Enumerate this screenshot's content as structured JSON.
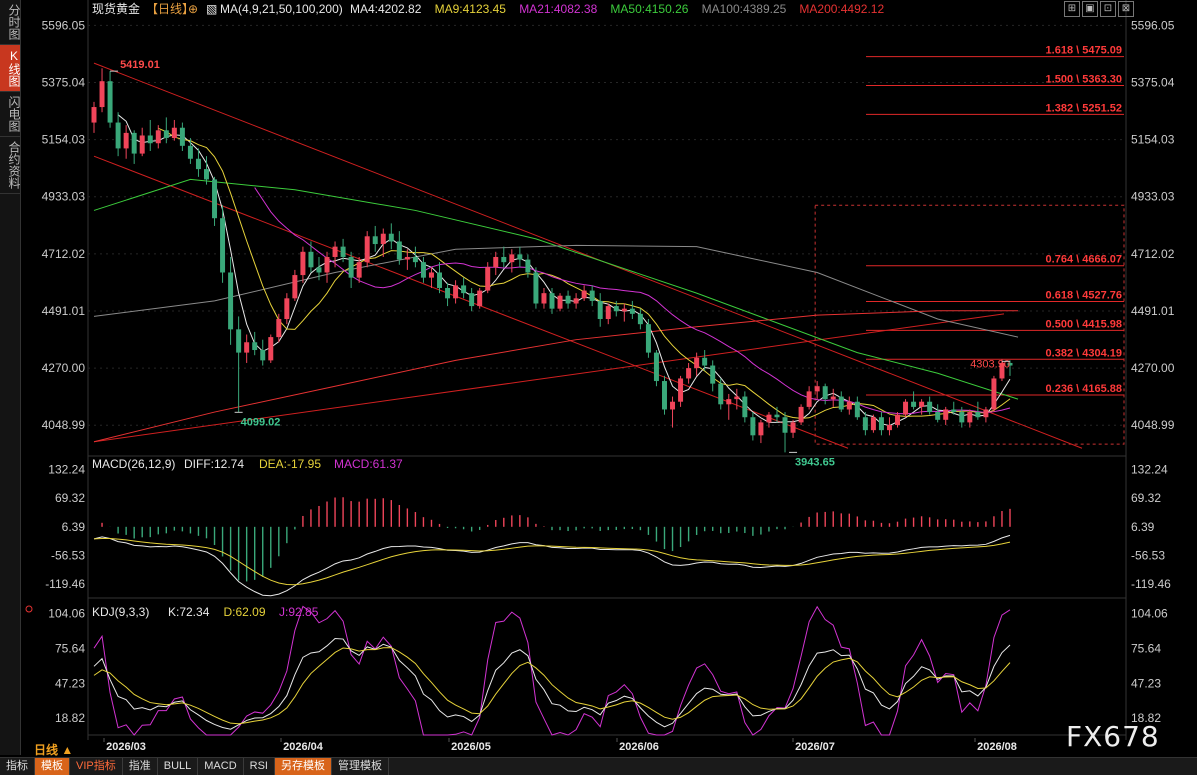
{
  "sidebar": {
    "tabs": [
      {
        "label": "分时图",
        "active": false
      },
      {
        "label": "K线图",
        "active": true
      },
      {
        "label": "闪电图",
        "active": false
      },
      {
        "label": "合约资料",
        "active": false
      }
    ]
  },
  "header": {
    "instrument": "现货黄金",
    "period_tag": "【日线】",
    "ma_title": "MA(4,9,21,50,100,200)",
    "ma_values": [
      {
        "label": "MA4:4202.82",
        "color": "#e8e8e8"
      },
      {
        "label": "MA9:4123.45",
        "color": "#e6d23a"
      },
      {
        "label": "MA21:4082.38",
        "color": "#d233d2"
      },
      {
        "label": "MA50:4150.26",
        "color": "#3ccc3c"
      },
      {
        "label": "MA100:4389.25",
        "color": "#8a8a8a"
      },
      {
        "label": "MA200:4492.12",
        "color": "#e63232"
      }
    ]
  },
  "toolbar": {
    "icons": [
      "expand-icon",
      "layout-icon",
      "window-icon",
      "close-icon"
    ],
    "glyphs": [
      "⊞",
      "▣",
      "⊡",
      "⊠"
    ]
  },
  "chart_data": [
    {
      "type": "candlestick",
      "title": "现货黄金 【日线】",
      "ylim": [
        3930,
        5640
      ],
      "y_ticks": [
        "5596.05",
        "5375.04",
        "5154.03",
        "4933.03",
        "4712.02",
        "4491.01",
        "4270.00",
        "4048.99"
      ],
      "x_ticks": [
        "2026/03",
        "2026/04",
        "2026/05",
        "2026/06",
        "2026/07",
        "2026/08"
      ],
      "candles": [
        [
          5220,
          5300,
          5180,
          5280
        ],
        [
          5280,
          5430,
          5260,
          5380
        ],
        [
          5380,
          5419,
          5200,
          5220
        ],
        [
          5220,
          5260,
          5090,
          5120
        ],
        [
          5120,
          5210,
          5080,
          5180
        ],
        [
          5180,
          5190,
          5060,
          5100
        ],
        [
          5100,
          5200,
          5090,
          5170
        ],
        [
          5170,
          5230,
          5110,
          5140
        ],
        [
          5140,
          5210,
          5120,
          5190
        ],
        [
          5190,
          5240,
          5140,
          5160
        ],
        [
          5160,
          5230,
          5150,
          5200
        ],
        [
          5200,
          5220,
          5110,
          5130
        ],
        [
          5130,
          5160,
          5060,
          5080
        ],
        [
          5080,
          5120,
          5010,
          5040
        ],
        [
          5040,
          5090,
          4980,
          5000
        ],
        [
          5000,
          5010,
          4820,
          4850
        ],
        [
          4850,
          4900,
          4600,
          4640
        ],
        [
          4640,
          4700,
          4360,
          4420
        ],
        [
          4420,
          4470,
          4099,
          4330
        ],
        [
          4330,
          4400,
          4290,
          4370
        ],
        [
          4370,
          4410,
          4320,
          4340
        ],
        [
          4340,
          4380,
          4280,
          4300
        ],
        [
          4300,
          4400,
          4290,
          4390
        ],
        [
          4390,
          4480,
          4370,
          4460
        ],
        [
          4460,
          4560,
          4440,
          4540
        ],
        [
          4540,
          4650,
          4530,
          4630
        ],
        [
          4630,
          4740,
          4600,
          4720
        ],
        [
          4720,
          4760,
          4640,
          4660
        ],
        [
          4660,
          4700,
          4610,
          4640
        ],
        [
          4640,
          4720,
          4600,
          4700
        ],
        [
          4700,
          4760,
          4660,
          4740
        ],
        [
          4740,
          4770,
          4680,
          4700
        ],
        [
          4700,
          4720,
          4580,
          4620
        ],
        [
          4620,
          4700,
          4600,
          4680
        ],
        [
          4680,
          4800,
          4660,
          4780
        ],
        [
          4780,
          4820,
          4720,
          4750
        ],
        [
          4750,
          4810,
          4700,
          4790
        ],
        [
          4790,
          4830,
          4730,
          4760
        ],
        [
          4760,
          4800,
          4670,
          4690
        ],
        [
          4690,
          4730,
          4650,
          4700
        ],
        [
          4700,
          4740,
          4660,
          4680
        ],
        [
          4680,
          4700,
          4600,
          4620
        ],
        [
          4620,
          4660,
          4580,
          4640
        ],
        [
          4640,
          4680,
          4560,
          4580
        ],
        [
          4580,
          4600,
          4510,
          4540
        ],
        [
          4540,
          4610,
          4520,
          4590
        ],
        [
          4590,
          4620,
          4540,
          4560
        ],
        [
          4560,
          4580,
          4490,
          4510
        ],
        [
          4510,
          4580,
          4500,
          4570
        ],
        [
          4570,
          4680,
          4560,
          4660
        ],
        [
          4660,
          4720,
          4630,
          4700
        ],
        [
          4700,
          4740,
          4660,
          4680
        ],
        [
          4680,
          4730,
          4640,
          4710
        ],
        [
          4710,
          4740,
          4660,
          4690
        ],
        [
          4690,
          4710,
          4620,
          4640
        ],
        [
          4640,
          4660,
          4500,
          4520
        ],
        [
          4520,
          4580,
          4500,
          4560
        ],
        [
          4560,
          4580,
          4480,
          4500
        ],
        [
          4500,
          4560,
          4490,
          4550
        ],
        [
          4550,
          4570,
          4500,
          4520
        ],
        [
          4520,
          4560,
          4500,
          4540
        ],
        [
          4540,
          4590,
          4530,
          4570
        ],
        [
          4570,
          4590,
          4510,
          4530
        ],
        [
          4530,
          4560,
          4430,
          4460
        ],
        [
          4460,
          4520,
          4440,
          4510
        ],
        [
          4510,
          4530,
          4470,
          4490
        ],
        [
          4490,
          4520,
          4450,
          4500
        ],
        [
          4500,
          4530,
          4460,
          4480
        ],
        [
          4480,
          4500,
          4420,
          4440
        ],
        [
          4440,
          4460,
          4310,
          4330
        ],
        [
          4330,
          4340,
          4200,
          4220
        ],
        [
          4220,
          4240,
          4090,
          4110
        ],
        [
          4110,
          4160,
          4040,
          4140
        ],
        [
          4140,
          4240,
          4120,
          4230
        ],
        [
          4230,
          4290,
          4210,
          4270
        ],
        [
          4270,
          4330,
          4240,
          4310
        ],
        [
          4310,
          4340,
          4260,
          4280
        ],
        [
          4280,
          4300,
          4180,
          4210
        ],
        [
          4210,
          4230,
          4110,
          4130
        ],
        [
          4130,
          4170,
          4070,
          4150
        ],
        [
          4150,
          4190,
          4110,
          4160
        ],
        [
          4160,
          4180,
          4060,
          4080
        ],
        [
          4080,
          4100,
          3990,
          4010
        ],
        [
          4010,
          4070,
          3980,
          4060
        ],
        [
          4060,
          4100,
          4040,
          4090
        ],
        [
          4090,
          4120,
          4060,
          4080
        ],
        [
          4080,
          4100,
          3944,
          4020
        ],
        [
          4020,
          4070,
          4000,
          4060
        ],
        [
          4060,
          4130,
          4050,
          4120
        ],
        [
          4120,
          4200,
          4110,
          4180
        ],
        [
          4180,
          4220,
          4150,
          4200
        ],
        [
          4200,
          4210,
          4130,
          4150
        ],
        [
          4150,
          4190,
          4120,
          4160
        ],
        [
          4160,
          4180,
          4100,
          4110
        ],
        [
          4110,
          4160,
          4090,
          4140
        ],
        [
          4140,
          4160,
          4070,
          4080
        ],
        [
          4080,
          4100,
          4010,
          4030
        ],
        [
          4030,
          4090,
          4020,
          4080
        ],
        [
          4080,
          4100,
          4010,
          4030
        ],
        [
          4030,
          4080,
          4010,
          4050
        ],
        [
          4050,
          4100,
          4040,
          4090
        ],
        [
          4090,
          4150,
          4080,
          4140
        ],
        [
          4140,
          4180,
          4110,
          4120
        ],
        [
          4120,
          4150,
          4090,
          4140
        ],
        [
          4140,
          4160,
          4090,
          4100
        ],
        [
          4100,
          4130,
          4060,
          4070
        ],
        [
          4070,
          4120,
          4050,
          4110
        ],
        [
          4110,
          4140,
          4090,
          4100
        ],
        [
          4100,
          4120,
          4040,
          4060
        ],
        [
          4060,
          4110,
          4040,
          4100
        ],
        [
          4100,
          4140,
          4070,
          4080
        ],
        [
          4080,
          4120,
          4060,
          4110
        ],
        [
          4110,
          4240,
          4100,
          4230
        ],
        [
          4230,
          4304,
          4220,
          4290
        ],
        [
          4290,
          4300,
          4240,
          4280
        ]
      ],
      "ma_series": [
        {
          "name": "MA4",
          "color": "#e8e8e8",
          "period": 4
        },
        {
          "name": "MA9",
          "color": "#e6d23a",
          "period": 9
        },
        {
          "name": "MA21",
          "color": "#d233d2",
          "period": 21
        }
      ],
      "long_mas": [
        {
          "name": "MA50",
          "color": "#3ccc3c",
          "points": [
            [
              0,
              4880
            ],
            [
              12,
              5000
            ],
            [
              25,
              4960
            ],
            [
              40,
              4880
            ],
            [
              55,
              4770
            ],
            [
              75,
              4560
            ],
            [
              95,
              4330
            ],
            [
              105,
              4250
            ],
            [
              115,
              4150
            ]
          ]
        },
        {
          "name": "MA100",
          "color": "#8a8a8a",
          "points": [
            [
              0,
              4470
            ],
            [
              15,
              4530
            ],
            [
              30,
              4640
            ],
            [
              45,
              4730
            ],
            [
              60,
              4745
            ],
            [
              75,
              4740
            ],
            [
              90,
              4640
            ],
            [
              105,
              4460
            ],
            [
              115,
              4390
            ]
          ]
        },
        {
          "name": "MA200",
          "color": "#e63232",
          "points": [
            [
              0,
              3985
            ],
            [
              15,
              4100
            ],
            [
              30,
              4200
            ],
            [
              45,
              4300
            ],
            [
              60,
              4380
            ],
            [
              75,
              4430
            ],
            [
              90,
              4475
            ],
            [
              105,
              4492
            ],
            [
              115,
              4492
            ]
          ]
        }
      ],
      "annotations": [
        {
          "label": "5419.01",
          "x": 2,
          "y": 5419,
          "anchor": "top"
        },
        {
          "label": "4099.02",
          "x": 18,
          "y": 4099,
          "anchor": "bottom"
        },
        {
          "label": "3943.65",
          "x": 87,
          "y": 3944,
          "anchor": "bottom"
        },
        {
          "label": "4303.90",
          "x": 113,
          "y": 4304,
          "anchor": "top"
        }
      ],
      "fib_levels": [
        {
          "label": "1.618 \\ 5475.09",
          "value": 5475.09
        },
        {
          "label": "1.500 \\ 5363.30",
          "value": 5363.3
        },
        {
          "label": "1.382 \\ 5251.52",
          "value": 5251.52
        },
        {
          "label": "0.764 \\ 4666.07",
          "value": 4666.07
        },
        {
          "label": "0.618 \\ 4527.76",
          "value": 4527.76
        },
        {
          "label": "0.500 \\ 4415.98",
          "value": 4415.98
        },
        {
          "label": "0.382 \\ 4304.19",
          "value": 4304.19
        },
        {
          "label": "0.236 \\ 4165.88",
          "value": 4165.88
        }
      ],
      "fib_box": {
        "x0": 90,
        "x1": 121,
        "y0": 4900,
        "y1": 3976
      }
    },
    {
      "type": "macd",
      "title": "MACD(26,12,9)",
      "labels": [
        {
          "text": "DIFF:12.74",
          "color": "#e8e8e8"
        },
        {
          "text": "DEA:-17.95",
          "color": "#e6d23a"
        },
        {
          "text": "MACD:61.37",
          "color": "#d233d2"
        }
      ],
      "ylim": [
        -150,
        140
      ],
      "y_ticks": [
        "132.24",
        "69.32",
        "6.39",
        "-56.53",
        "-119.46"
      ]
    },
    {
      "type": "kdj",
      "title": "KDJ(9,3,3)",
      "labels": [
        {
          "text": "K:72.34",
          "color": "#e8e8e8"
        },
        {
          "text": "D:62.09",
          "color": "#e6d23a"
        },
        {
          "text": "J:92.85",
          "color": "#d233d2"
        }
      ],
      "ylim": [
        5,
        112
      ],
      "y_ticks": [
        "104.06",
        "75.64",
        "47.23",
        "18.82"
      ]
    }
  ],
  "footer": {
    "period": "日线 ▲",
    "tabs": [
      {
        "label": "指标",
        "style": "normal"
      },
      {
        "label": "模板",
        "style": "active"
      },
      {
        "label": "VIP指标",
        "style": "vip"
      },
      {
        "label": "指准",
        "style": "normal"
      },
      {
        "label": "BULL",
        "style": "normal"
      },
      {
        "label": "MACD",
        "style": "normal"
      },
      {
        "label": "RSI",
        "style": "normal"
      },
      {
        "label": "另存模板",
        "style": "active"
      },
      {
        "label": "管理模板",
        "style": "normal"
      }
    ],
    "brand": "FX678"
  },
  "colors": {
    "up": "#f0455a",
    "down": "#3aa87a",
    "grid": "#262626",
    "axis_text": "#cccccc"
  }
}
